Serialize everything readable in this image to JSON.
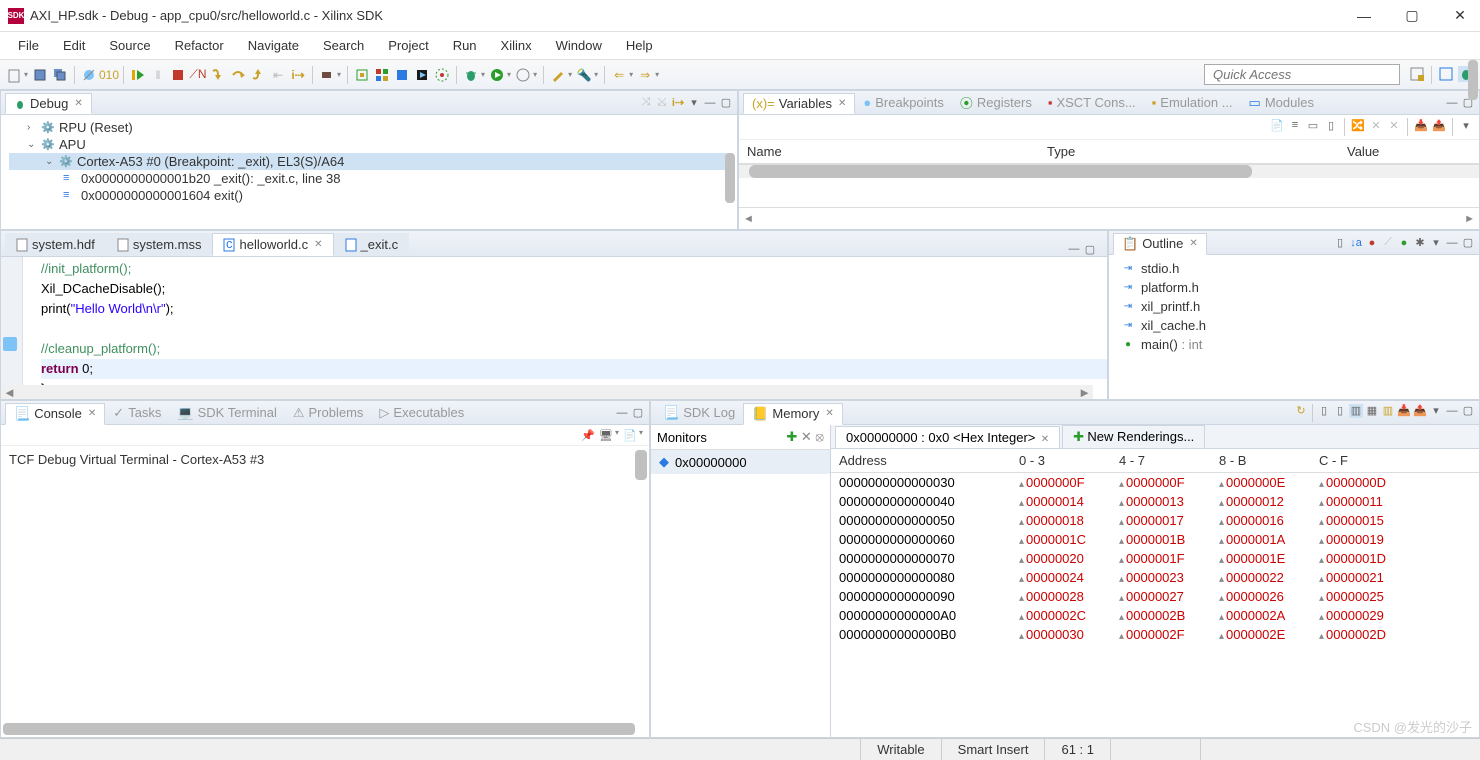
{
  "title": "AXI_HP.sdk - Debug - app_cpu0/src/helloworld.c - Xilinx SDK",
  "menu": [
    "File",
    "Edit",
    "Source",
    "Refactor",
    "Navigate",
    "Search",
    "Project",
    "Run",
    "Xilinx",
    "Window",
    "Help"
  ],
  "quick_access": "Quick Access",
  "debug_view": {
    "label": "Debug",
    "nodes": {
      "rpu": "RPU (Reset)",
      "apu": "APU",
      "core": "Cortex-A53 #0 (Breakpoint: _exit), EL3(S)/A64",
      "frame0": "0x0000000000001b20 _exit(): _exit.c, line 38",
      "frame1": "0x0000000000001604 exit()"
    }
  },
  "vars_view": {
    "tabs": [
      "Variables",
      "Breakpoints",
      "Registers",
      "XSCT Cons...",
      "Emulation ...",
      "Modules"
    ],
    "columns": [
      "Name",
      "Type",
      "Value"
    ]
  },
  "editor_tabs": [
    "system.hdf",
    "system.mss",
    "helloworld.c",
    "_exit.c"
  ],
  "code": {
    "l1": "Xil_DCacheDisable();",
    "l2a": "print(",
    "l2b": "\"Hello World\\n\\r\"",
    "l2c": ");",
    "l3": "//cleanup_platform();",
    "l4a": "return",
    "l4b": " 0;",
    "l5": "}"
  },
  "outline": {
    "label": "Outline",
    "items": [
      "stdio.h",
      "platform.h",
      "xil_printf.h",
      "xil_cache.h"
    ],
    "main_label": "main()",
    "main_type": " : int"
  },
  "console": {
    "tabs": [
      "Console",
      "Tasks",
      "SDK Terminal",
      "Problems",
      "Executables"
    ],
    "title": "TCF Debug Virtual Terminal - Cortex-A53 #3"
  },
  "memory": {
    "sdk_log": "SDK Log",
    "label": "Memory",
    "monitors_label": "Monitors",
    "monitor_addr": "0x00000000",
    "rendering_tab": "0x00000000 : 0x0 <Hex Integer>",
    "new_rendering": "New Renderings...",
    "columns": [
      "Address",
      "0 - 3",
      "4 - 7",
      "8 - B",
      "C - F"
    ],
    "rows": [
      {
        "addr": "0000000000000030",
        "cells": [
          "0000000F",
          "0000000F",
          "0000000E",
          "0000000D"
        ]
      },
      {
        "addr": "0000000000000040",
        "cells": [
          "00000014",
          "00000013",
          "00000012",
          "00000011"
        ]
      },
      {
        "addr": "0000000000000050",
        "cells": [
          "00000018",
          "00000017",
          "00000016",
          "00000015"
        ]
      },
      {
        "addr": "0000000000000060",
        "cells": [
          "0000001C",
          "0000001B",
          "0000001A",
          "00000019"
        ]
      },
      {
        "addr": "0000000000000070",
        "cells": [
          "00000020",
          "0000001F",
          "0000001E",
          "0000001D"
        ]
      },
      {
        "addr": "0000000000000080",
        "cells": [
          "00000024",
          "00000023",
          "00000022",
          "00000021"
        ]
      },
      {
        "addr": "0000000000000090",
        "cells": [
          "00000028",
          "00000027",
          "00000026",
          "00000025"
        ]
      },
      {
        "addr": "00000000000000A0",
        "cells": [
          "0000002C",
          "0000002B",
          "0000002A",
          "00000029"
        ]
      },
      {
        "addr": "00000000000000B0",
        "cells": [
          "00000030",
          "0000002F",
          "0000002E",
          "0000002D"
        ]
      }
    ]
  },
  "statusbar": {
    "writable": "Writable",
    "insert": "Smart Insert",
    "pos": "61 : 1"
  },
  "watermark": "CSDN @发光的沙子"
}
